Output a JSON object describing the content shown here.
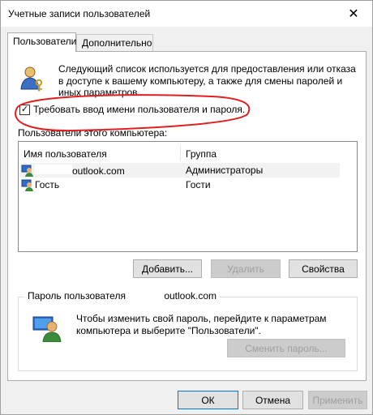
{
  "window": {
    "title": "Учетные записи пользователей"
  },
  "tabs": [
    {
      "label": "Пользователи",
      "active": true
    },
    {
      "label": "Дополнительно",
      "active": false
    }
  ],
  "description": "Следующий список используется для предоставления или отказа в доступе к вашему компьютеру, а также для смены паролей и иных параметров.",
  "require_login": {
    "label": "Требовать ввод имени пользователя и пароля.",
    "checked": true
  },
  "users_label": "Пользователи этого компьютера:",
  "columns": {
    "name": "Имя пользователя",
    "group": "Группа"
  },
  "users": [
    {
      "name": "outlook.com",
      "group": "Администраторы",
      "selected": true
    },
    {
      "name": "Гость",
      "group": "Гости",
      "selected": false
    }
  ],
  "buttons": {
    "add": "Добавить...",
    "remove": "Удалить",
    "properties": "Свойства",
    "change_password": "Сменить пароль...",
    "ok": "ОК",
    "cancel": "Отмена",
    "apply": "Применить"
  },
  "password_section": {
    "title_prefix": "Пароль пользователя",
    "title_suffix": "outlook.com",
    "text": "Чтобы изменить свой пароль, перейдите к параметрам компьютера и выберите \"Пользователи\"."
  },
  "colors": {
    "annotation": "#e02020",
    "selection": "#f2f2f2"
  },
  "icons": {
    "close": "close-icon",
    "users": "users-info-icon",
    "user": "user-icon",
    "password": "user-password-icon"
  }
}
